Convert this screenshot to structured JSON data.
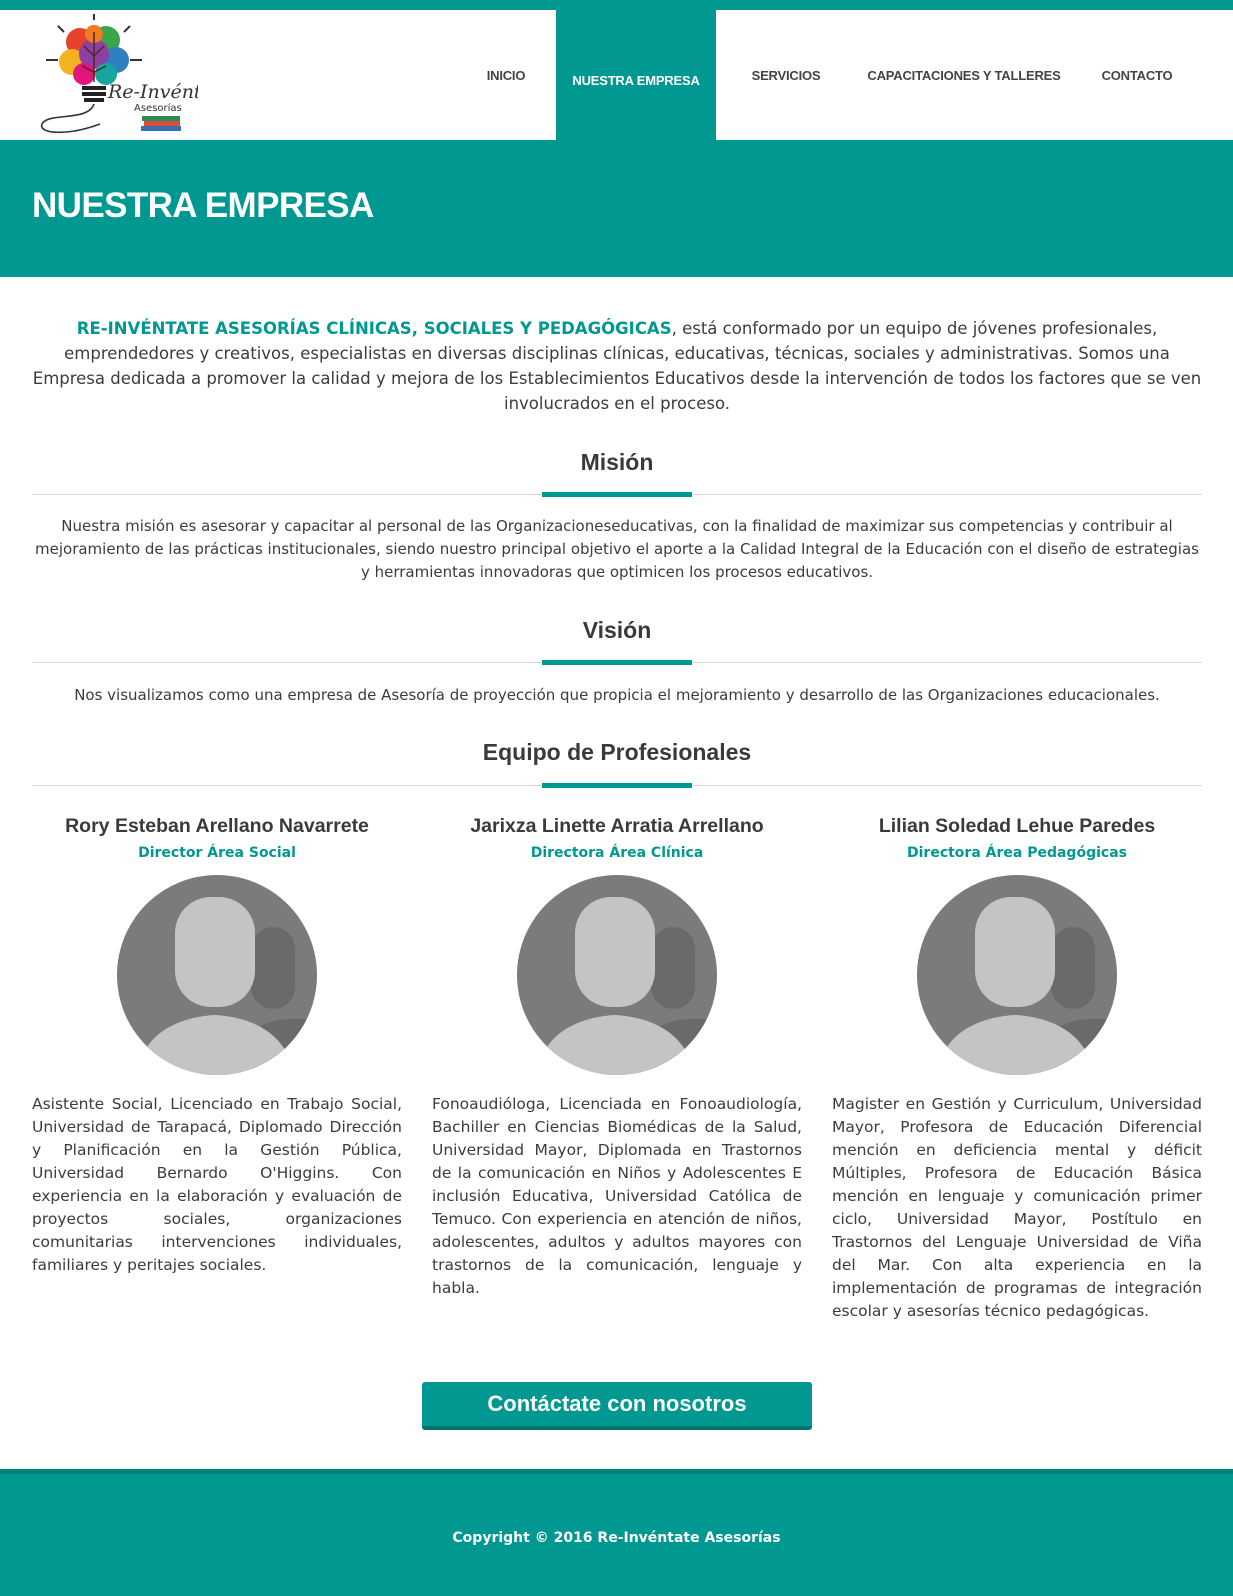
{
  "colors": {
    "brand": "#009890",
    "brand_dark": "#00827b",
    "text": "#3c3c3c"
  },
  "logo": {
    "word": "Re-Invéntate",
    "sub": "Asesorías"
  },
  "nav": {
    "items": [
      {
        "label": "INICIO",
        "active": false
      },
      {
        "label": "NUESTRA EMPRESA",
        "active": true
      },
      {
        "label": "SERVICIOS",
        "active": false
      },
      {
        "label": "CAPACITACIONES Y TALLERES",
        "active": false
      },
      {
        "label": "CONTACTO",
        "active": false
      }
    ]
  },
  "hero": {
    "title": "NUESTRA EMPRESA"
  },
  "intro": {
    "brand": "RE-INVÉNTATE ASESORÍAS CLÍNICAS, SOCIALES Y PEDAGÓGICAS",
    "text": ", está conformado por un equipo de jóvenes profesionales, emprendedores y creativos, especialistas en diversas disciplinas clínicas, educativas, técnicas, sociales y administrativas. Somos una Empresa dedicada a promover la calidad y mejora de los Establecimientos Educativos desde la intervención de todos los factores que se ven involucrados en el proceso."
  },
  "mision": {
    "title": "Misión",
    "text": "Nuestra misión es asesorar y capacitar al personal de las Organizacioneseducativas, con la finalidad de maximizar sus competencias y contribuir al mejoramiento de las prácticas institucionales, siendo nuestro principal objetivo el aporte a la Calidad Integral de la Educación con el diseño de estrategias y herramientas innovadoras que optimicen los procesos educativos."
  },
  "vision": {
    "title": "Visión",
    "text": "Nos visualizamos como una empresa de Asesoría de proyección que propicia el mejoramiento y desarrollo de las Organizaciones educacionales."
  },
  "team": {
    "title": "Equipo de Profesionales",
    "members": [
      {
        "name": "Rory Esteban Arellano Navarrete",
        "role": "Director Área Social",
        "bio": "Asistente Social, Licenciado en Trabajo Social, Universidad de Tarapacá, Diplomado Dirección y Planificación en la Gestión Pública, Universidad Bernardo O'Higgins. Con experiencia en la elaboración y evaluación de proyectos sociales, organizaciones comunitarias intervenciones individuales, familiares y peritajes sociales."
      },
      {
        "name": "Jarixza Linette Arratia Arrellano",
        "role": "Directora Área Clínica",
        "bio": "Fonoaudióloga, Licenciada en Fonoaudiología, Bachiller en Ciencias Biomédicas de la Salud, Universidad Mayor, Diplomada en Trastornos de la comunicación en Niños y Adolescentes E inclusión Educativa, Universidad Católica de Temuco. Con experiencia en atención de niños, adolescentes, adultos y adultos mayores con trastornos de la comunicación, lenguaje y habla."
      },
      {
        "name": "Lilian Soledad Lehue Paredes",
        "role": "Directora Área Pedagógicas",
        "bio": "Magister en Gestión y Curriculum, Universidad Mayor, Profesora de Educación Diferencial mención en deficiencia mental y déficit Múltiples, Profesora de Educación Básica mención en lenguaje y comunicación primer ciclo, Universidad Mayor, Postítulo en Trastornos del Lenguaje Universidad de Viña del Mar. Con alta experiencia en la implementación de programas de integración escolar y asesorías técnico pedagógicas."
      }
    ]
  },
  "cta": {
    "label": "Contáctate con nosotros"
  },
  "footer": {
    "copyright": "Copyright © 2016 Re-Invéntate Asesorías"
  }
}
